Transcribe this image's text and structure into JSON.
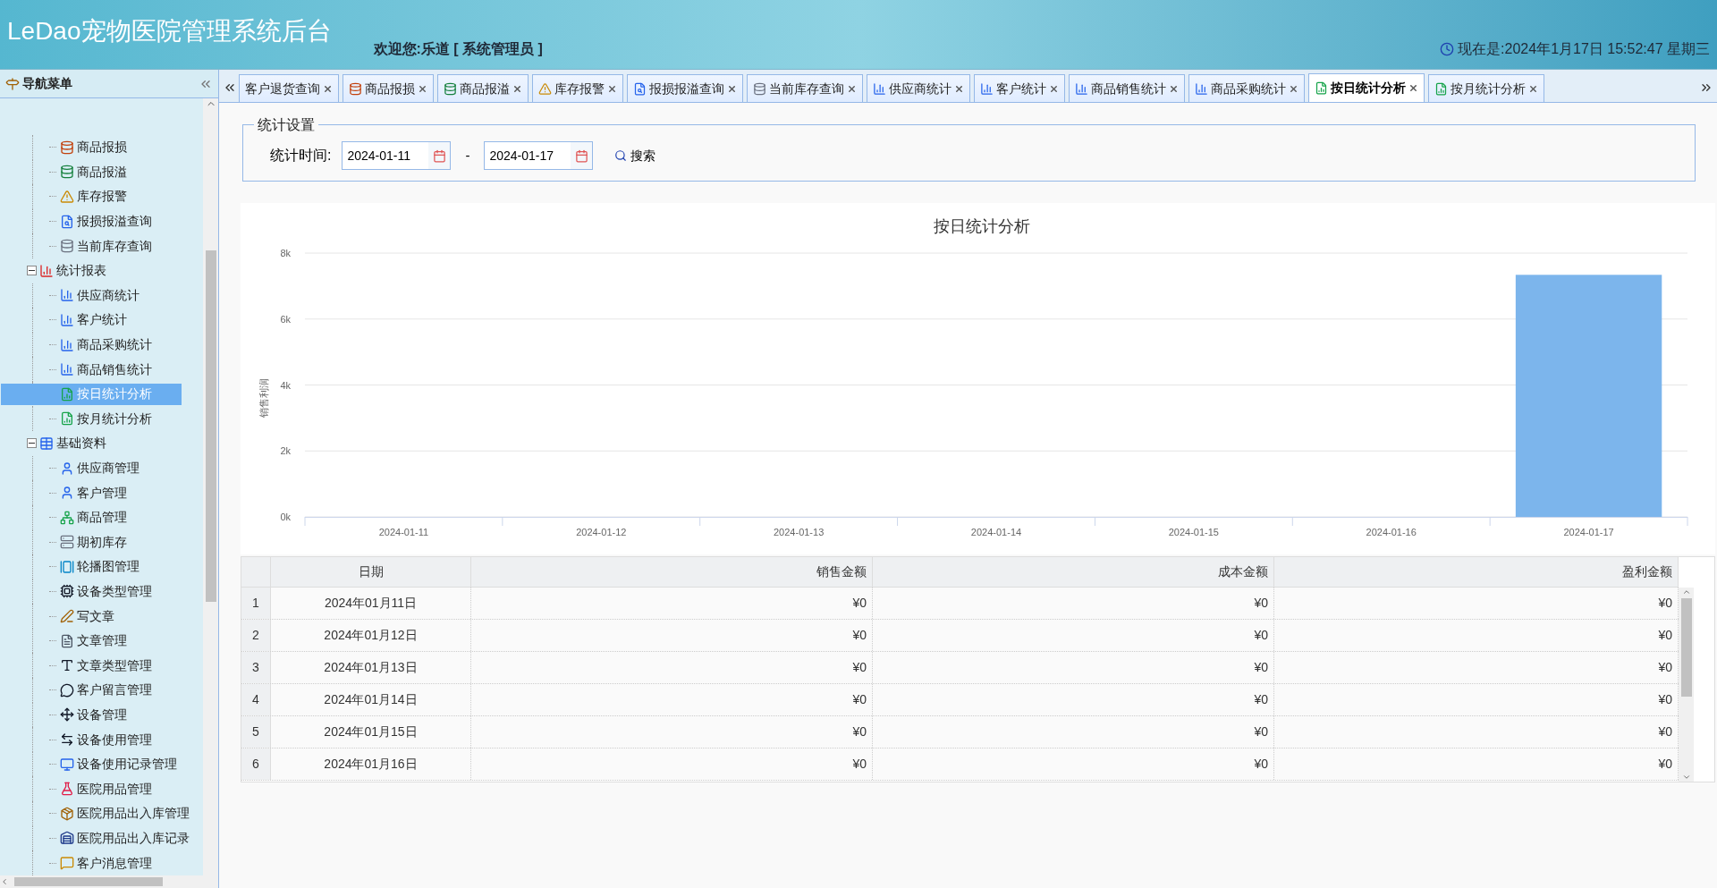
{
  "header": {
    "title": "LeDao宠物医院管理系统后台",
    "welcome": "欢迎您:乐道 [ 系统管理员 ]",
    "clock": "现在是:2024年1月17日 15:52:47 星期三"
  },
  "sidebar": {
    "title": "导航菜单",
    "tree": [
      {
        "children": [
          {
            "label": "商品报损",
            "selected": false
          },
          {
            "label": "商品报溢",
            "selected": false
          },
          {
            "label": "库存报警",
            "selected": false
          },
          {
            "label": "报损报溢查询",
            "selected": false
          },
          {
            "label": "当前库存查询",
            "selected": false
          }
        ]
      },
      {
        "label": "统计报表",
        "expanded": true,
        "children": [
          {
            "label": "供应商统计",
            "selected": false
          },
          {
            "label": "客户统计",
            "selected": false
          },
          {
            "label": "商品采购统计",
            "selected": false
          },
          {
            "label": "商品销售统计",
            "selected": false
          },
          {
            "label": "按日统计分析",
            "selected": true
          },
          {
            "label": "按月统计分析",
            "selected": false
          }
        ]
      },
      {
        "label": "基础资料",
        "expanded": true,
        "children": [
          {
            "label": "供应商管理",
            "selected": false
          },
          {
            "label": "客户管理",
            "selected": false
          },
          {
            "label": "商品管理",
            "selected": false
          },
          {
            "label": "期初库存",
            "selected": false
          },
          {
            "label": "轮播图管理",
            "selected": false
          },
          {
            "label": "设备类型管理",
            "selected": false
          },
          {
            "label": "写文章",
            "selected": false
          },
          {
            "label": "文章管理",
            "selected": false
          },
          {
            "label": "文章类型管理",
            "selected": false
          },
          {
            "label": "客户留言管理",
            "selected": false
          },
          {
            "label": "设备管理",
            "selected": false
          },
          {
            "label": "设备使用管理",
            "selected": false
          },
          {
            "label": "设备使用记录管理",
            "selected": false
          },
          {
            "label": "医院用品管理",
            "selected": false
          },
          {
            "label": "医院用品出入库管理",
            "selected": false
          },
          {
            "label": "医院用品出入库记录",
            "selected": false
          },
          {
            "label": "客户消息管理",
            "selected": false
          }
        ]
      }
    ]
  },
  "tabs": [
    {
      "label": "客户退货查询",
      "selected": false
    },
    {
      "label": "商品报损",
      "selected": false
    },
    {
      "label": "商品报溢",
      "selected": false
    },
    {
      "label": "库存报警",
      "selected": false
    },
    {
      "label": "报损报溢查询",
      "selected": false
    },
    {
      "label": "当前库存查询",
      "selected": false
    },
    {
      "label": "供应商统计",
      "selected": false
    },
    {
      "label": "客户统计",
      "selected": false
    },
    {
      "label": "商品销售统计",
      "selected": false
    },
    {
      "label": "商品采购统计",
      "selected": false
    },
    {
      "label": "按日统计分析",
      "selected": true
    },
    {
      "label": "按月统计分析",
      "selected": false
    }
  ],
  "settings": {
    "legend": "统计设置",
    "time_label": "统计时间:",
    "start": "2024-01-11",
    "separator": "-",
    "end": "2024-01-17",
    "search": "搜索"
  },
  "chart": {
    "chart_data": {
      "type": "bar",
      "title": "按日统计分析",
      "ylabel": "销售利润",
      "categories": [
        "2024-01-11",
        "2024-01-12",
        "2024-01-13",
        "2024-01-14",
        "2024-01-15",
        "2024-01-16",
        "2024-01-17"
      ],
      "values": [
        0,
        0,
        0,
        0,
        0,
        0,
        7340
      ],
      "ylim": [
        0,
        8000
      ],
      "grid": true,
      "yticks": [
        {
          "value": 0,
          "label": "0k"
        },
        {
          "value": 2000,
          "label": "2k"
        },
        {
          "value": 4000,
          "label": "4k"
        },
        {
          "value": 6000,
          "label": "6k"
        },
        {
          "value": 8000,
          "label": "8k"
        }
      ]
    }
  },
  "table": {
    "columns": [
      "日期",
      "销售金额",
      "成本金额",
      "盈利金额"
    ],
    "rows": [
      {
        "index": "1",
        "cells": [
          "2024年01月11日",
          "¥0",
          "¥0",
          "¥0"
        ]
      },
      {
        "index": "2",
        "cells": [
          "2024年01月12日",
          "¥0",
          "¥0",
          "¥0"
        ]
      },
      {
        "index": "3",
        "cells": [
          "2024年01月13日",
          "¥0",
          "¥0",
          "¥0"
        ]
      },
      {
        "index": "4",
        "cells": [
          "2024年01月14日",
          "¥0",
          "¥0",
          "¥0"
        ]
      },
      {
        "index": "5",
        "cells": [
          "2024年01月15日",
          "¥0",
          "¥0",
          "¥0"
        ]
      },
      {
        "index": "6",
        "cells": [
          "2024年01月16日",
          "¥0",
          "¥0",
          "¥0"
        ]
      }
    ]
  }
}
